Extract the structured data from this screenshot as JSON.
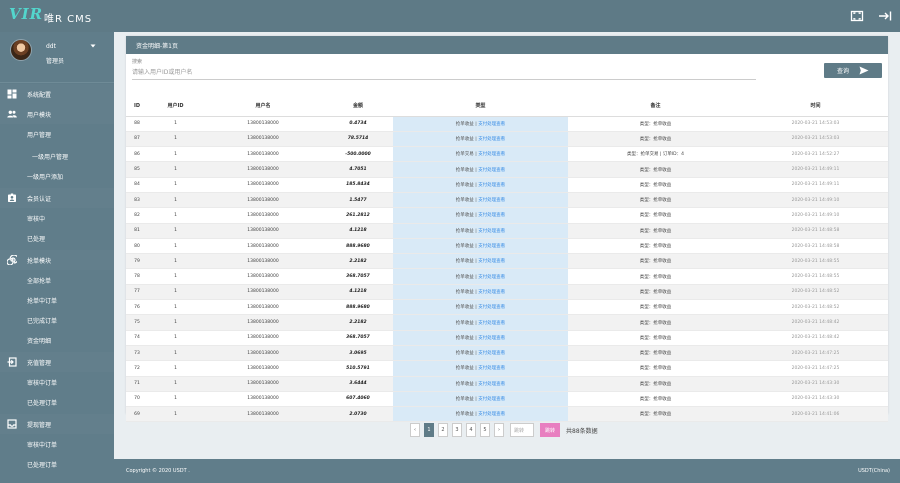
{
  "topbar": {
    "logo": "VIR",
    "brand": "唯R CMS",
    "icons": {
      "fullscreen": "fullscreen-icon",
      "logout": "logout-icon"
    }
  },
  "user": {
    "name": "ddt",
    "role": "管理员"
  },
  "nav": [
    {
      "kind": "parent",
      "label": "系统配置",
      "icon": "dashboard-icon"
    },
    {
      "kind": "parent",
      "label": "用户模块",
      "icon": "users-icon"
    },
    {
      "kind": "child",
      "label": "用户管理"
    },
    {
      "kind": "grand",
      "label": "一级用户管理"
    },
    {
      "kind": "child",
      "label": "一级用户添加"
    },
    {
      "kind": "parent",
      "label": "会员认证",
      "icon": "id-card-icon"
    },
    {
      "kind": "child",
      "label": "审核中"
    },
    {
      "kind": "child",
      "label": "已处理"
    },
    {
      "kind": "parent",
      "label": "抢单模块",
      "icon": "swirl-icon"
    },
    {
      "kind": "child",
      "label": "全部抢单"
    },
    {
      "kind": "child",
      "label": "抢单中订单"
    },
    {
      "kind": "child",
      "label": "已完成订单"
    },
    {
      "kind": "child",
      "label": "资金明细"
    },
    {
      "kind": "parent",
      "label": "充值管理",
      "icon": "login-box-icon"
    },
    {
      "kind": "child",
      "label": "审核中订单"
    },
    {
      "kind": "child",
      "label": "已处理订单"
    },
    {
      "kind": "parent",
      "label": "提现管理",
      "icon": "inbox-icon"
    },
    {
      "kind": "child",
      "label": "审核中订单"
    },
    {
      "kind": "child",
      "label": "已处理订单"
    }
  ],
  "panel": {
    "title": "资金明细-第1页",
    "search_label": "搜索",
    "search_placeholder": "请输入用户ID或用户名",
    "search_button": "查询"
  },
  "table": {
    "columns": [
      "ID",
      "用户ID",
      "用户名",
      "金额",
      "类型",
      "备注",
      "时间"
    ],
    "rows": [
      {
        "id": "88",
        "uid": "1",
        "username": "13800138000",
        "amount": "0.4734",
        "type": "抢单收益",
        "type_link": "支付处理查看",
        "note": "类型：抢单收益",
        "time": "2020-03-21 14:53:03"
      },
      {
        "id": "87",
        "uid": "1",
        "username": "13800138000",
        "amount": "78.5714",
        "type": "抢单收益",
        "type_link": "支付处理查看",
        "note": "类型：抢单收益",
        "time": "2020-03-21 14:53:03"
      },
      {
        "id": "86",
        "uid": "1",
        "username": "13800138000",
        "amount": "-500.0000",
        "type": "抢单交易",
        "type_link": "支付处理查看",
        "note": "类型：抢单交易 | 订单ID：4",
        "time": "2020-03-21 14:52:27"
      },
      {
        "id": "85",
        "uid": "1",
        "username": "13800138000",
        "amount": "4.7051",
        "type": "抢单收益",
        "type_link": "支付处理查看",
        "note": "类型：抢单收益",
        "time": "2020-03-21 14:49:11"
      },
      {
        "id": "84",
        "uid": "1",
        "username": "13800138000",
        "amount": "185.8434",
        "type": "抢单收益",
        "type_link": "支付处理查看",
        "note": "类型：抢单收益",
        "time": "2020-03-21 14:49:11"
      },
      {
        "id": "83",
        "uid": "1",
        "username": "13800138000",
        "amount": "1.5477",
        "type": "抢单收益",
        "type_link": "支付处理查看",
        "note": "类型：抢单收益",
        "time": "2020-03-21 14:49:10"
      },
      {
        "id": "82",
        "uid": "1",
        "username": "13800138000",
        "amount": "261.2812",
        "type": "抢单收益",
        "type_link": "支付处理查看",
        "note": "类型：抢单收益",
        "time": "2020-03-21 14:49:10"
      },
      {
        "id": "81",
        "uid": "1",
        "username": "13800138000",
        "amount": "4.1218",
        "type": "抢单收益",
        "type_link": "支付处理查看",
        "note": "类型：抢单收益",
        "time": "2020-03-21 14:48:58"
      },
      {
        "id": "80",
        "uid": "1",
        "username": "13800138000",
        "amount": "888.9680",
        "type": "抢单收益",
        "type_link": "支付处理查看",
        "note": "类型：抢单收益",
        "time": "2020-03-21 14:48:58"
      },
      {
        "id": "79",
        "uid": "1",
        "username": "13800138000",
        "amount": "2.2182",
        "type": "抢单收益",
        "type_link": "支付处理查看",
        "note": "类型：抢单收益",
        "time": "2020-03-21 14:48:55"
      },
      {
        "id": "78",
        "uid": "1",
        "username": "13800138000",
        "amount": "368.7057",
        "type": "抢单收益",
        "type_link": "支付处理查看",
        "note": "类型：抢单收益",
        "time": "2020-03-21 14:48:55"
      },
      {
        "id": "77",
        "uid": "1",
        "username": "13800138000",
        "amount": "4.1218",
        "type": "抢单收益",
        "type_link": "支付处理查看",
        "note": "类型：抢单收益",
        "time": "2020-03-21 14:48:52"
      },
      {
        "id": "76",
        "uid": "1",
        "username": "13800138000",
        "amount": "888.9680",
        "type": "抢单收益",
        "type_link": "支付处理查看",
        "note": "类型：抢单收益",
        "time": "2020-03-21 14:48:52"
      },
      {
        "id": "75",
        "uid": "1",
        "username": "13800138000",
        "amount": "2.2182",
        "type": "抢单收益",
        "type_link": "支付处理查看",
        "note": "类型：抢单收益",
        "time": "2020-03-21 14:48:42"
      },
      {
        "id": "74",
        "uid": "1",
        "username": "13800138000",
        "amount": "368.7057",
        "type": "抢单收益",
        "type_link": "支付处理查看",
        "note": "类型：抢单收益",
        "time": "2020-03-21 14:48:42"
      },
      {
        "id": "73",
        "uid": "1",
        "username": "13800138000",
        "amount": "3.0695",
        "type": "抢单收益",
        "type_link": "支付处理查看",
        "note": "类型：抢单收益",
        "time": "2020-03-21 14:47:25"
      },
      {
        "id": "72",
        "uid": "1",
        "username": "13800138000",
        "amount": "510.5791",
        "type": "抢单收益",
        "type_link": "支付处理查看",
        "note": "类型：抢单收益",
        "time": "2020-03-21 14:47:25"
      },
      {
        "id": "71",
        "uid": "1",
        "username": "13800138000",
        "amount": "3.6444",
        "type": "抢单收益",
        "type_link": "支付处理查看",
        "note": "类型：抢单收益",
        "time": "2020-03-21 14:43:30"
      },
      {
        "id": "70",
        "uid": "1",
        "username": "13800138000",
        "amount": "607.4060",
        "type": "抢单收益",
        "type_link": "支付处理查看",
        "note": "类型：抢单收益",
        "time": "2020-03-21 14:43:30"
      },
      {
        "id": "69",
        "uid": "1",
        "username": "13800138000",
        "amount": "2.0730",
        "type": "抢单收益",
        "type_link": "支付处理查看",
        "note": "类型：抢单收益",
        "time": "2020-03-21 14:41:06"
      }
    ]
  },
  "pager": {
    "prev": "‹",
    "pages": [
      "1",
      "2",
      "3",
      "4",
      "5"
    ],
    "active": "1",
    "next": "›",
    "jump_placeholder": "跳转",
    "go": "跳转",
    "total": "共88条数据"
  },
  "footer": {
    "left": "Copyright © 2020 USDT .",
    "right": "USDT(China)"
  },
  "colors": {
    "bar": "#5e7a86",
    "sidebar": "#607d8a",
    "logo": "#53d6cd",
    "type_cell": "#d9eaf7",
    "go_button": "#e87fc0"
  }
}
